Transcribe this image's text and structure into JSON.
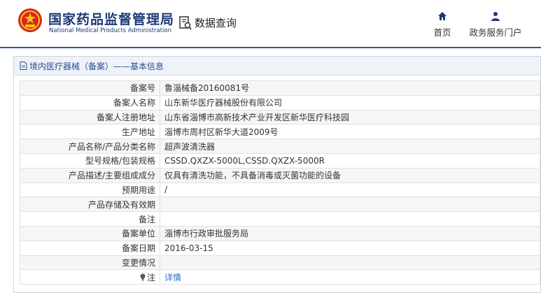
{
  "header": {
    "title_cn": "国家药品监督管理局",
    "title_en": "National Medical Products Administration",
    "query_label": "数据查询",
    "nav": [
      {
        "label": "首页",
        "icon": "home-icon"
      },
      {
        "label": "政务服务门户",
        "icon": "user-icon"
      }
    ]
  },
  "colors": {
    "brand": "#1d3a78",
    "accent": "#2b5ba8",
    "link": "#2b6cc4"
  },
  "panel": {
    "title": "境内医疗器械（备案）——基本信息"
  },
  "record": [
    {
      "key": "备案号",
      "value": "鲁淄械备20160081号"
    },
    {
      "key": "备案人名称",
      "value": "山东新华医疗器械股份有限公司"
    },
    {
      "key": "备案人注册地址",
      "value": "山东省淄博市高新技术产业开发区新华医疗科技园"
    },
    {
      "key": "生产地址",
      "value": "淄博市周村区新华大道2009号"
    },
    {
      "key": "产品名称/产品分类名称",
      "value": "超声波清洗器"
    },
    {
      "key": "型号规格/包装规格",
      "value": "CSSD.QXZX-5000L,CSSD.QXZX-5000R"
    },
    {
      "key": "产品描述/主要组成成分",
      "value": "仅具有清洗功能，不具备消毒或灭菌功能的设备"
    },
    {
      "key": "预期用途",
      "value": "/"
    },
    {
      "key": "产品存储及有效期",
      "value": ""
    },
    {
      "key": "备注",
      "value": ""
    },
    {
      "key": "备案单位",
      "value": "淄博市行政审批服务局"
    },
    {
      "key": "备案日期",
      "value": "2016-03-15"
    },
    {
      "key": "变更情况",
      "value": ""
    },
    {
      "key": "注",
      "value": "详情"
    }
  ]
}
